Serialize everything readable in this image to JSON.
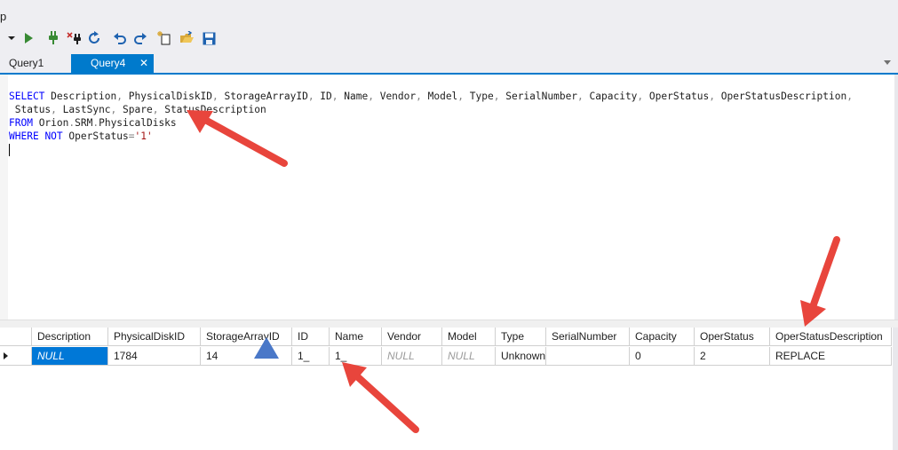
{
  "menubar": {
    "partial_label": "p"
  },
  "toolbar": {
    "icons": [
      "dropdown-arrow-icon",
      "run-icon",
      "connect-icon",
      "disconnect-icon",
      "refresh-icon",
      "undo-icon",
      "redo-icon",
      "new-query-icon",
      "open-file-icon",
      "save-icon"
    ],
    "colors": {
      "run": "#388a34",
      "connect": "#388a34",
      "disconnect_x": "#c5302e",
      "blue": "#1e62b0",
      "save": "#1e62b0",
      "open": "#d9a93b"
    }
  },
  "tabs": [
    {
      "label": "Query1",
      "active": false
    },
    {
      "label": "Query4",
      "active": true,
      "close": "✕"
    }
  ],
  "editor": {
    "line1": [
      "SELECT",
      " Description",
      ", ",
      "PhysicalDiskID",
      ", ",
      "StorageArrayID",
      ", ",
      "ID",
      ", ",
      "Name",
      ", ",
      "Vendor",
      ", ",
      "Model",
      ", ",
      "Type",
      ", ",
      "SerialNumber",
      ", ",
      "Capacity",
      ", ",
      "OperStatus",
      ", ",
      "OperStatusDescription",
      ","
    ],
    "line2": [
      "Status",
      ", ",
      "LastSync",
      ", ",
      "Spare",
      ", ",
      "StatusDescription"
    ],
    "line3": [
      "FROM",
      " Orion",
      ".",
      "SRM",
      ".",
      "PhysicalDisks"
    ],
    "line4": [
      "WHERE",
      " ",
      "NOT",
      " OperStatus",
      "=",
      "'1'"
    ]
  },
  "grid": {
    "columns": [
      "Description",
      "PhysicalDiskID",
      "StorageArrayID",
      "ID",
      "Name",
      "Vendor",
      "Model",
      "Type",
      "SerialNumber",
      "Capacity",
      "OperStatus",
      "OperStatusDescription"
    ],
    "rows": [
      [
        "NULL",
        "1784",
        "14",
        "1_",
        "1_",
        "NULL",
        "NULL",
        "Unknown",
        "",
        "0",
        "2",
        "REPLACE"
      ]
    ]
  },
  "annotations": {
    "arrow_color": "#e8453c",
    "marker_color": "#4a78c8"
  }
}
